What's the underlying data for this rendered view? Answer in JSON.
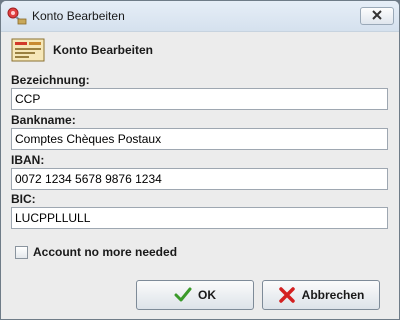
{
  "window": {
    "title": "Konto Bearbeiten"
  },
  "header": {
    "title": "Konto Bearbeiten"
  },
  "fields": {
    "bezeichnung": {
      "label": "Bezeichnung:",
      "value": "CCP"
    },
    "bankname": {
      "label": "Bankname:",
      "value": "Comptes Chèques Postaux"
    },
    "iban": {
      "label": "IBAN:",
      "value": "0072 1234 5678 9876 1234"
    },
    "bic": {
      "label": "BIC:",
      "value": "LUCPPLLULL"
    }
  },
  "checkbox": {
    "label": "Account no more needed",
    "checked": false
  },
  "buttons": {
    "ok": "OK",
    "cancel": "Abbrechen"
  },
  "icons": {
    "app": "money-pin-icon",
    "header": "bank-account-icon",
    "close": "close-icon",
    "ok": "checkmark-icon",
    "cancel": "red-x-icon"
  },
  "colors": {
    "ok_icon": "#3a9a2a",
    "cancel_icon": "#d42020",
    "close_x": "#333333"
  }
}
